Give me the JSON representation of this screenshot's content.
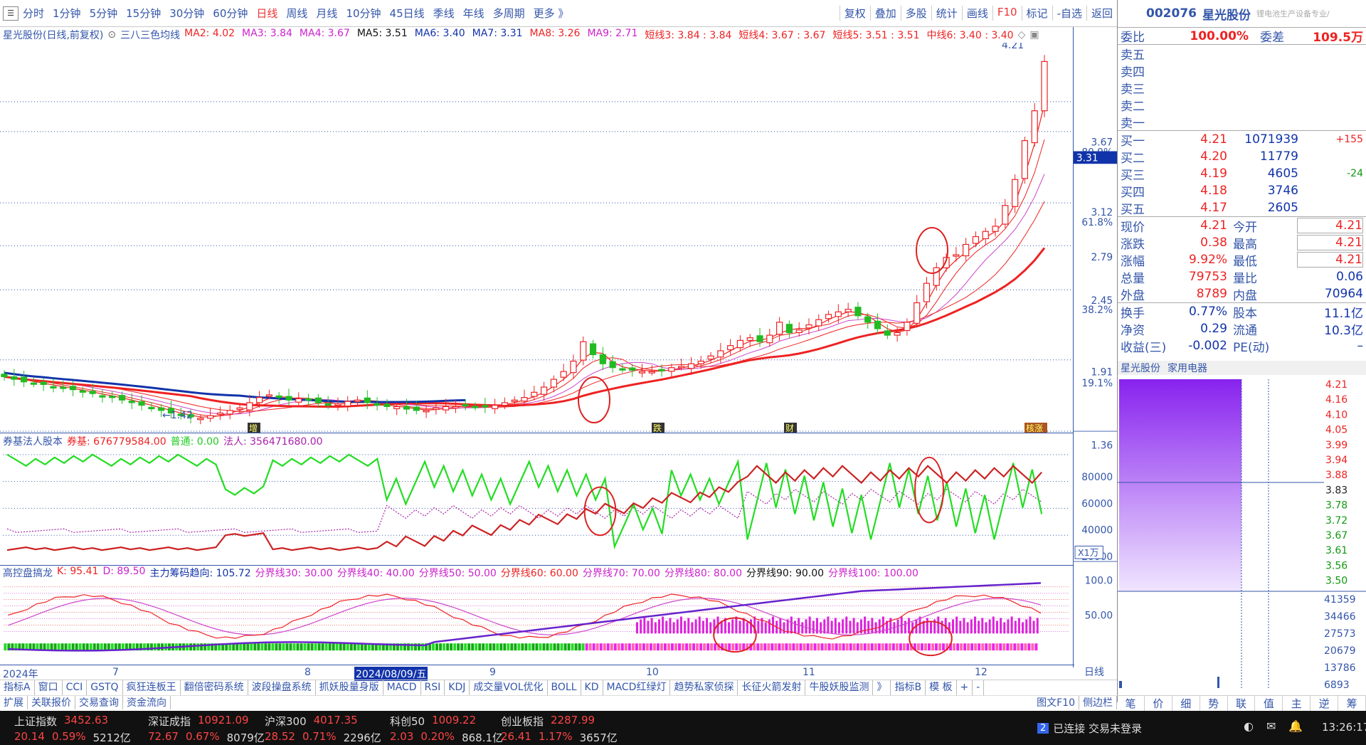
{
  "toolbar": {
    "periods": [
      "分时",
      "1分钟",
      "5分钟",
      "15分钟",
      "30分钟",
      "60分钟",
      "日线",
      "周线",
      "月线",
      "10分钟",
      "45日线",
      "季线",
      "年线",
      "多周期",
      "更多 》"
    ],
    "active_period": "日线",
    "tools": [
      "复权",
      "叠加",
      "多股",
      "统计",
      "画线",
      "F10",
      "标记",
      "-自选",
      "返回"
    ]
  },
  "ma_line": {
    "title": "星光股份(日线,前复权)",
    "indicator": "三八三色均线",
    "items": [
      {
        "label": "MA2: 4.02",
        "color": "#ee2222"
      },
      {
        "label": "MA3: 3.84",
        "color": "#cc22cc"
      },
      {
        "label": "MA4: 3.67",
        "color": "#cc22cc"
      },
      {
        "label": "MA5: 3.51",
        "color": "#111111"
      },
      {
        "label": "MA6: 3.40",
        "color": "#1133aa"
      },
      {
        "label": "MA7: 3.31",
        "color": "#1133aa"
      },
      {
        "label": "MA8: 3.26",
        "color": "#ee2222"
      },
      {
        "label": "MA9: 2.71",
        "color": "#cc22cc"
      },
      {
        "label": "短线3: 3.84 : 3.84",
        "color": "#ee2222"
      },
      {
        "label": "短线4: 3.67 : 3.67",
        "color": "#ee2222"
      },
      {
        "label": "短线5: 3.51 : 3.51",
        "color": "#ee2222"
      },
      {
        "label": "中线6: 3.40 : 3.40",
        "color": "#ee2222"
      }
    ]
  },
  "price_axis": {
    "ticks": [
      "3.67",
      "3.12",
      "2.79",
      "2.45",
      "1.91",
      "1.36"
    ],
    "pcts": [
      "80.9%",
      "61.8%",
      "38.2%",
      "19.1%"
    ],
    "cursor": "3.31",
    "high_label": "4.21",
    "low_label": "1.42"
  },
  "markers": [
    "增",
    "跌",
    "财",
    "核涨"
  ],
  "sub1": {
    "legend": [
      {
        "label": "券基法人股本",
        "color": "#3355aa"
      },
      {
        "label": "券基: 676779584.00",
        "color": "#ee2222"
      },
      {
        "label": "普通: 0.00",
        "color": "#22cc22"
      },
      {
        "label": "法人: 356471680.00",
        "color": "#aa22aa"
      }
    ],
    "ticks": [
      "80000",
      "60000",
      "40000",
      "20000"
    ],
    "unit": "X1万"
  },
  "sub2": {
    "legend": [
      {
        "label": "高控盘搞龙",
        "color": "#3355aa"
      },
      {
        "label": "K: 95.41",
        "color": "#ee2222"
      },
      {
        "label": "D: 89.50",
        "color": "#cc22cc"
      },
      {
        "label": "主力筹码趋向: 105.72",
        "color": "#1133aa"
      },
      {
        "label": "分界线30: 30.00",
        "color": "#cc22cc"
      },
      {
        "label": "分界线40: 40.00",
        "color": "#cc22cc"
      },
      {
        "label": "分界线50: 50.00",
        "color": "#cc22cc"
      },
      {
        "label": "分界线60: 60.00",
        "color": "#ee2222"
      },
      {
        "label": "分界线70: 70.00",
        "color": "#cc22cc"
      },
      {
        "label": "分界线80: 80.00",
        "color": "#cc22cc"
      },
      {
        "label": "分界线90: 90.00",
        "color": "#111111"
      },
      {
        "label": "分界线100: 100.00",
        "color": "#cc22cc"
      }
    ],
    "ticks": [
      "100.0",
      "50.00"
    ]
  },
  "dates": {
    "labels": [
      "2024年",
      "7",
      "8",
      "2024/08/09/五",
      "9",
      "10",
      "11",
      "12"
    ],
    "right": "日线"
  },
  "tabs1": [
    "指标A",
    "窗口",
    "CCI",
    "GSTQ",
    "疯狂连板王",
    "翻倍密码系统",
    "波段操盘系统",
    "抓妖股量身版",
    "MACD",
    "RSI",
    "KDJ",
    "成交量VOL优化",
    "BOLL",
    "KD",
    "MACD红绿灯",
    "趋势私家侦探",
    "长征火箭发射",
    "牛股妖股监测",
    "》",
    "指标B",
    "模 板",
    "+",
    "-"
  ],
  "tabs2": [
    "扩展",
    "关联报价",
    "交易查询",
    "资金流向"
  ],
  "quote": {
    "code": "002076",
    "name": "星光股份",
    "tag": "锂电池生产设备专业/",
    "weibi_label": "委比",
    "weibi": "100.00%",
    "weicha_label": "委差",
    "weicha": "109.5万",
    "sells": [
      "卖五",
      "卖四",
      "卖三",
      "卖二",
      "卖一"
    ],
    "buys": [
      {
        "label": "买一",
        "price": "4.21",
        "vol": "1071939",
        "chg": "+155"
      },
      {
        "label": "买二",
        "price": "4.20",
        "vol": "11779",
        "chg": ""
      },
      {
        "label": "买三",
        "price": "4.19",
        "vol": "4605",
        "chg": "-24"
      },
      {
        "label": "买四",
        "price": "4.18",
        "vol": "3746",
        "chg": ""
      },
      {
        "label": "买五",
        "price": "4.17",
        "vol": "2605",
        "chg": ""
      }
    ],
    "stats": [
      {
        "l1": "现价",
        "v1": "4.21",
        "l2": "今开",
        "v2": "4.21"
      },
      {
        "l1": "涨跌",
        "v1": "0.38",
        "l2": "最高",
        "v2": "4.21"
      },
      {
        "l1": "涨幅",
        "v1": "9.92%",
        "l2": "最低",
        "v2": "4.21"
      },
      {
        "l1": "总量",
        "v1": "79753",
        "l2": "量比",
        "v2": "0.06"
      },
      {
        "l1": "外盘",
        "v1": "8789",
        "l2": "内盘",
        "v2": "70964"
      }
    ],
    "stats2": [
      {
        "l1": "换手",
        "v1": "0.77%",
        "l2": "股本",
        "v2": "11.1亿"
      },
      {
        "l1": "净资",
        "v1": "0.29",
        "l2": "流通",
        "v2": "10.3亿"
      },
      {
        "l1": "收益(三)",
        "v1": "-0.002",
        "l2": "PE(动)",
        "v2": "–"
      }
    ]
  },
  "mini": {
    "title1": "星光股份",
    "title2": "家用电器",
    "prices": [
      "4.21",
      "4.16",
      "4.10",
      "4.05",
      "3.99",
      "3.94",
      "3.88",
      "3.83",
      "3.78",
      "3.72",
      "3.67",
      "3.61",
      "3.56",
      "3.50"
    ],
    "vols": [
      "41359",
      "34466",
      "27573",
      "20679",
      "13786",
      "6893"
    ]
  },
  "bottom_tabs": [
    "笔",
    "价",
    "细",
    "势",
    "联",
    "值",
    "主",
    "逆",
    "筹"
  ],
  "bottom_extra": "图文F10",
  "bottom_extra2": "侧边栏",
  "status": {
    "indices": [
      {
        "name": "上证指数",
        "val": "3452.63",
        "chg": "20.14",
        "pct": "0.59%",
        "amt": "5212亿"
      },
      {
        "name": "深证成指",
        "val": "10921.09",
        "chg": "72.67",
        "pct": "0.67%",
        "amt": "8079亿"
      },
      {
        "name": "沪深300",
        "val": "4017.35",
        "chg": "28.52",
        "pct": "0.71%",
        "amt": "2296亿"
      },
      {
        "name": "科创50",
        "val": "1009.22",
        "chg": "2.03",
        "pct": "0.20%",
        "amt": "868.1亿"
      },
      {
        "name": "创业板指",
        "val": "2287.99",
        "chg": "26.41",
        "pct": "1.17%",
        "amt": "3657亿"
      }
    ],
    "conn_badge": "2",
    "conn_text": "已连接 交易未登录",
    "time": "13:26:17"
  },
  "chart_data": {
    "type": "candlestick",
    "title": "星光股份(日线,前复权)",
    "ylim": [
      1.36,
      4.3
    ],
    "y_ticks": [
      1.36,
      1.91,
      2.45,
      2.79,
      3.12,
      3.67
    ],
    "x_months": [
      "2024年",
      "7",
      "8",
      "9",
      "10",
      "11",
      "12"
    ],
    "highest": 4.21,
    "lowest": 1.42,
    "closes": [
      1.78,
      1.76,
      1.74,
      1.73,
      1.72,
      1.7,
      1.69,
      1.68,
      1.66,
      1.65,
      1.63,
      1.62,
      1.6,
      1.58,
      1.56,
      1.54,
      1.52,
      1.5,
      1.48,
      1.47,
      1.46,
      1.48,
      1.5,
      1.52,
      1.54,
      1.58,
      1.62,
      1.64,
      1.62,
      1.6,
      1.61,
      1.6,
      1.58,
      1.56,
      1.57,
      1.59,
      1.6,
      1.58,
      1.56,
      1.55,
      1.55,
      1.53,
      1.52,
      1.52,
      1.54,
      1.55,
      1.55,
      1.56,
      1.55,
      1.55,
      1.56,
      1.58,
      1.6,
      1.62,
      1.66,
      1.7,
      1.76,
      1.82,
      1.9,
      2.05,
      1.95,
      1.88,
      1.85,
      1.84,
      1.83,
      1.82,
      1.82,
      1.83,
      1.85,
      1.86,
      1.88,
      1.9,
      1.94,
      1.98,
      2.02,
      2.06,
      2.08,
      2.05,
      2.1,
      2.2,
      2.12,
      2.14,
      2.18,
      2.22,
      2.26,
      2.28,
      2.3,
      2.25,
      2.2,
      2.15,
      2.1,
      2.12,
      2.2,
      2.35,
      2.5,
      2.62,
      2.7,
      2.72,
      2.8,
      2.86,
      2.9,
      2.94,
      3.1,
      3.3,
      3.6,
      3.83,
      4.21
    ]
  }
}
